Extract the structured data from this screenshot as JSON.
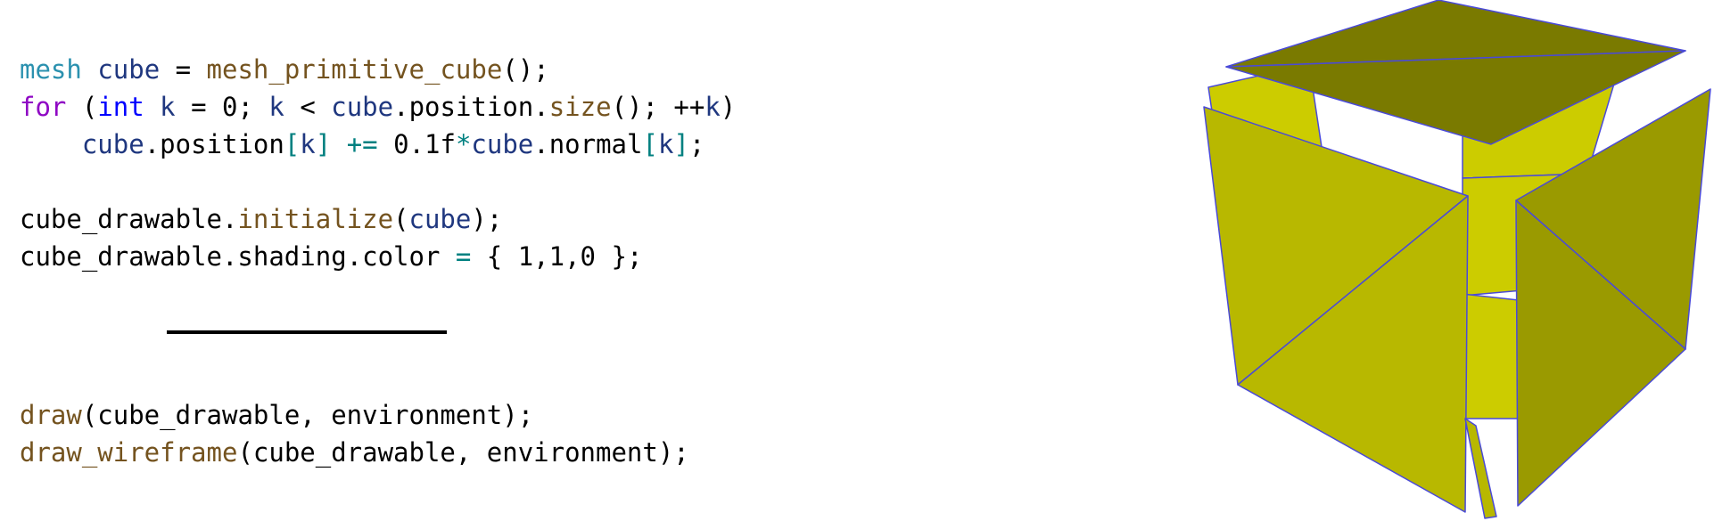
{
  "code_block_1": [
    [
      [
        "mesh",
        "type"
      ],
      [
        " ",
        "plain"
      ],
      [
        "cube",
        "var"
      ],
      [
        " = ",
        "plain"
      ],
      [
        "mesh_primitive_cube",
        "func"
      ],
      [
        "();",
        "plain"
      ]
    ],
    [
      [
        "for",
        "kw"
      ],
      [
        " (",
        "plain"
      ],
      [
        "int",
        "kw2"
      ],
      [
        " ",
        "plain"
      ],
      [
        "k",
        "var"
      ],
      [
        " = 0; ",
        "plain"
      ],
      [
        "k",
        "var"
      ],
      [
        " < ",
        "plain"
      ],
      [
        "cube",
        "var"
      ],
      [
        ".position.",
        "plain"
      ],
      [
        "size",
        "func"
      ],
      [
        "(); ++",
        "plain"
      ],
      [
        "k",
        "var"
      ],
      [
        ")",
        "plain"
      ]
    ],
    [
      [
        "    ",
        "plain"
      ],
      [
        "cube",
        "var"
      ],
      [
        ".position",
        "plain"
      ],
      [
        "[",
        "op"
      ],
      [
        "k",
        "var"
      ],
      [
        "]",
        "op"
      ],
      [
        " ",
        "plain"
      ],
      [
        "+=",
        "op"
      ],
      [
        " 0.1f",
        "plain"
      ],
      [
        "*",
        "op"
      ],
      [
        "cube",
        "var"
      ],
      [
        ".normal",
        "plain"
      ],
      [
        "[",
        "op"
      ],
      [
        "k",
        "var"
      ],
      [
        "]",
        "op"
      ],
      [
        ";",
        "plain"
      ]
    ],
    [],
    [
      [
        "cube_drawable.",
        "plain"
      ],
      [
        "initialize",
        "func"
      ],
      [
        "(",
        "plain"
      ],
      [
        "cube",
        "var"
      ],
      [
        ");",
        "plain"
      ]
    ],
    [
      [
        "cube_drawable.shading.color ",
        "plain"
      ],
      [
        "=",
        "op"
      ],
      [
        " { 1,1,0 };",
        "plain"
      ]
    ]
  ],
  "code_block_2": [
    [
      [
        "draw",
        "func"
      ],
      [
        "(cube_drawable, environment);",
        "plain"
      ]
    ],
    [
      [
        "draw_wireframe",
        "func"
      ],
      [
        "(cube_drawable, environment);",
        "plain"
      ]
    ]
  ],
  "colors": {
    "type": "#2b91af",
    "var": "#1f377f",
    "func": "#74531f",
    "kw": "#8f08c4",
    "kw2": "#0000ff",
    "op": "#008080",
    "plain": "#000000",
    "cube_top": "#7a7a00",
    "cube_left": "#b8b800",
    "cube_right": "#9a9a00",
    "cube_back": "#cccc00",
    "cube_edge": "#4a4ad8"
  }
}
